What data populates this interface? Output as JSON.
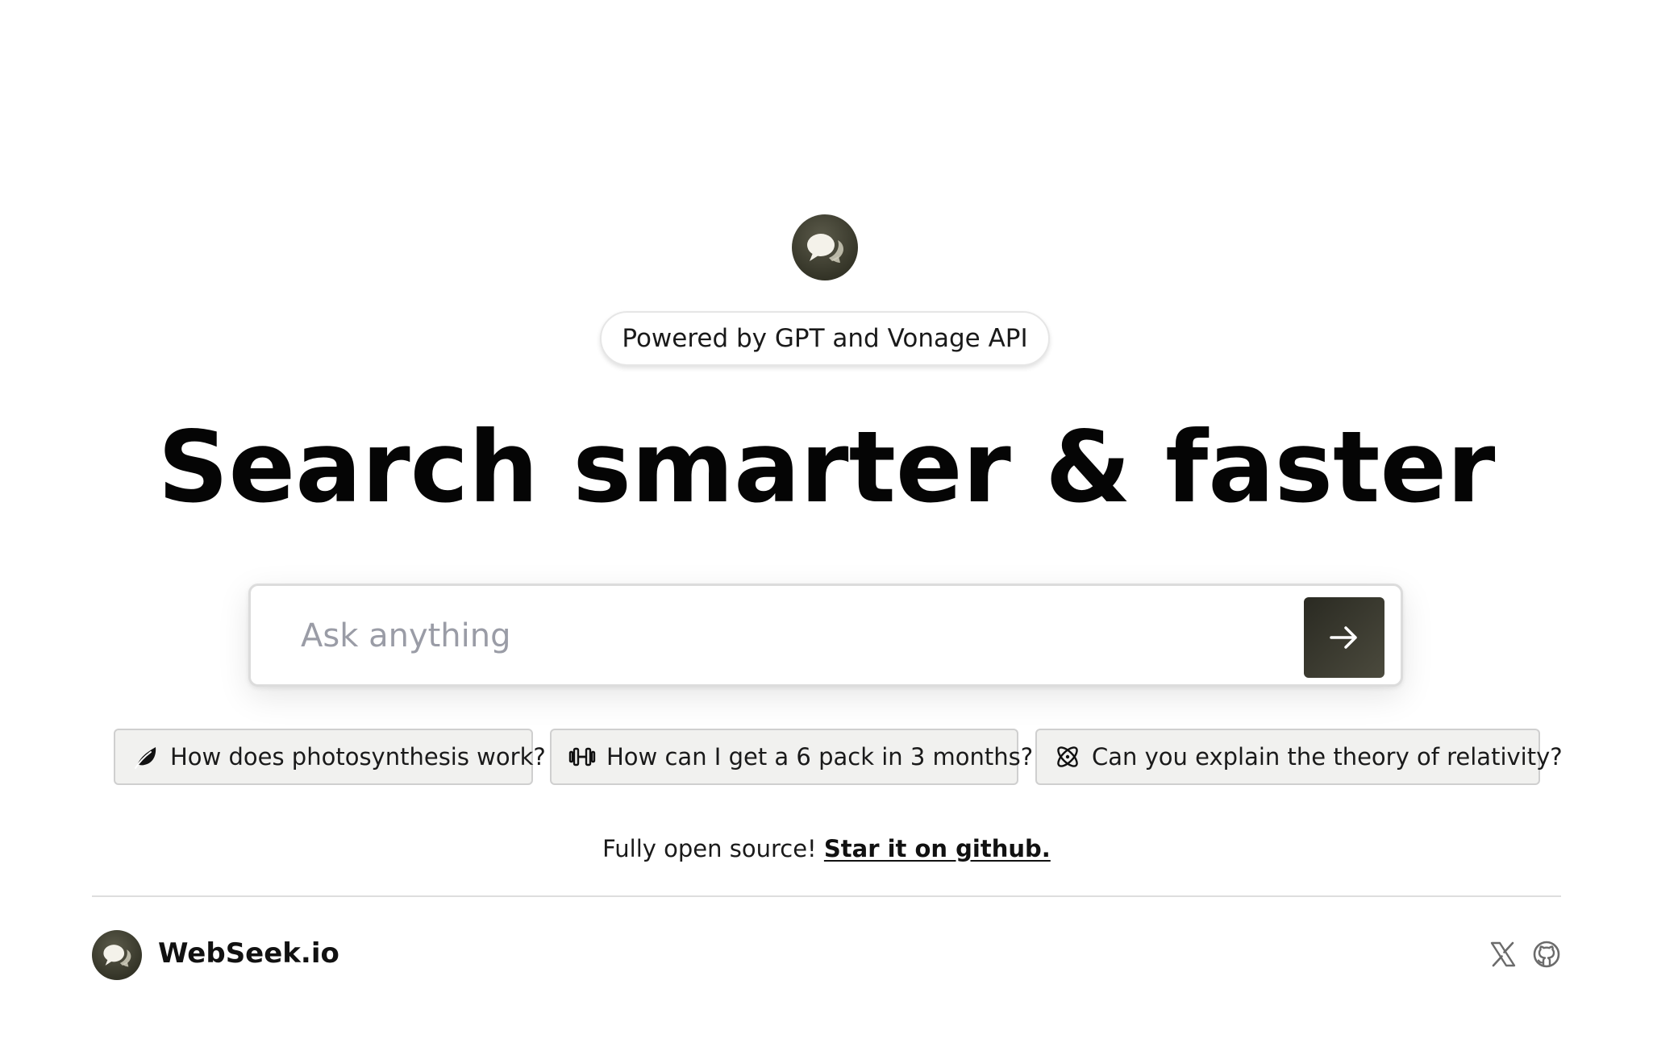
{
  "header": {
    "logo_icon": "chat-bubbles-icon",
    "powered_by": "Powered by GPT and Vonage API",
    "headline": "Search smarter & faster"
  },
  "search": {
    "placeholder": "Ask anything",
    "value": "",
    "submit_icon": "arrow-right-icon"
  },
  "suggestions": [
    {
      "icon": "leaf-icon",
      "label": "How does photosynthesis work?"
    },
    {
      "icon": "dumbbell-icon",
      "label": "How can I get a 6 pack in 3 months?"
    },
    {
      "icon": "atom-icon",
      "label": "Can you explain the theory of relativity?"
    }
  ],
  "open_source": {
    "text": "Fully open source!",
    "link_label": "Star it on github."
  },
  "footer": {
    "brand": "WebSeek.io",
    "social": [
      {
        "icon": "x-twitter-icon"
      },
      {
        "icon": "github-icon"
      }
    ]
  },
  "colors": {
    "accent_dark": "#2f2f26",
    "chip_background": "#f1f1ef",
    "placeholder": "#9a9ca6"
  }
}
